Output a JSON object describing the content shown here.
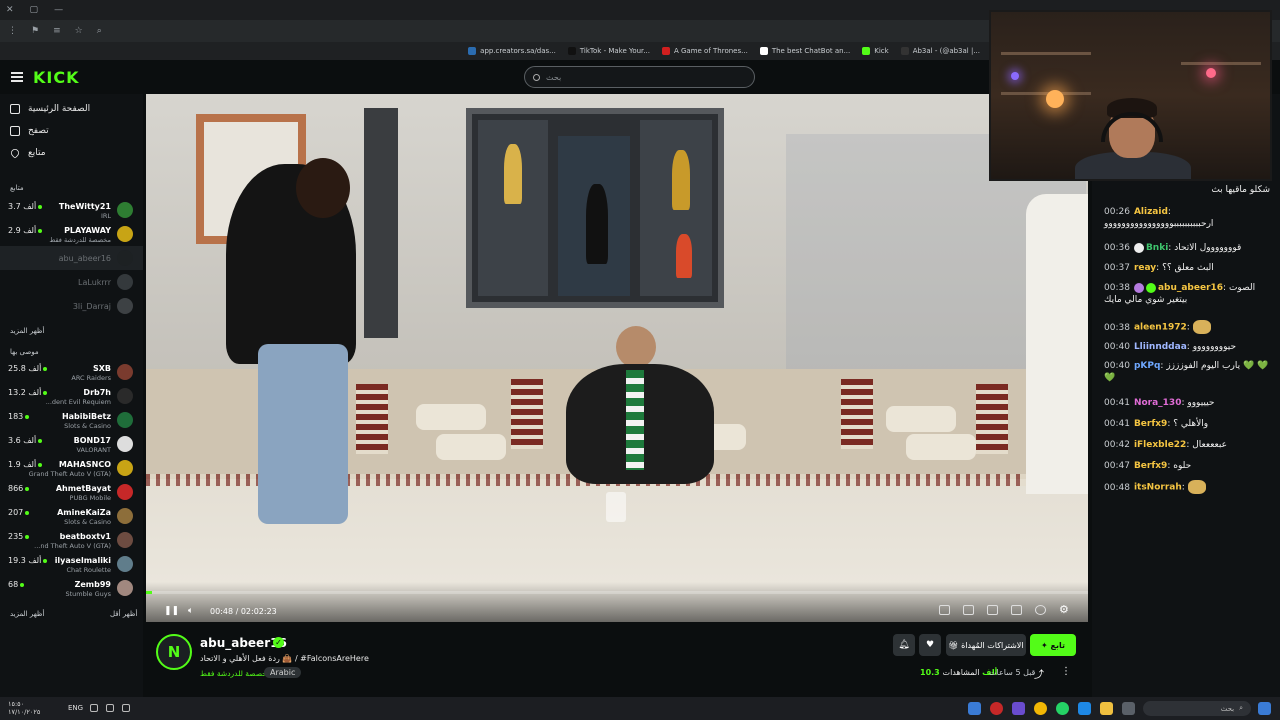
{
  "browser": {
    "tab_hint": "kic",
    "bookmarks": [
      {
        "label": "app.creators.sa/das...",
        "color": "#2b6cb0"
      },
      {
        "label": "TikTok - Make Your...",
        "color": "#111111"
      },
      {
        "label": "A Game of Thrones...",
        "color": "#d11f1f"
      },
      {
        "label": "The best ChatBot an...",
        "color": "#ffffff"
      },
      {
        "label": "Kick",
        "color": "#53fc18"
      },
      {
        "label": "Ab3al - (@ab3al |...",
        "color": "#333333"
      }
    ]
  },
  "header": {
    "logo": "KICK",
    "search_placeholder": "بحث"
  },
  "sidebar": {
    "nav": [
      {
        "label": "الصفحة الرئيسية",
        "icon": "home-icon"
      },
      {
        "label": "تصفح",
        "icon": "browse-icon"
      },
      {
        "label": "متابع",
        "icon": "heart-icon"
      }
    ],
    "following_label": "متابع",
    "following": [
      {
        "count": "3.7 ألف",
        "name": "TheWitty21",
        "category": "IRL",
        "live": true,
        "avatar": "#2e7d32"
      },
      {
        "count": "2.9 ألف",
        "name": "PLAYAWAY",
        "category": "مخصصة للدردشة فقط",
        "live": true,
        "avatar": "#c8a415"
      },
      {
        "count": "",
        "name": "abu_abeer16",
        "category": "",
        "live": false,
        "active": true,
        "avatar": "#1b1f22"
      },
      {
        "count": "",
        "name": "LaLukrrr",
        "category": "",
        "live": false,
        "avatar": "#5a5f63"
      },
      {
        "count": "",
        "name": "3li_Darraj",
        "category": "",
        "live": false,
        "avatar": "#6b6f73"
      }
    ],
    "show_more_following": "أظهر المزيد",
    "recommended_label": "موصى بها",
    "recommended": [
      {
        "count": "25.8 ألف",
        "name": "SXB",
        "category": "ARC Raiders",
        "avatar": "#7a3b2e"
      },
      {
        "count": "13.2 ألف",
        "name": "Drb7h",
        "category": "...dent Evil Requiem",
        "avatar": "#2a2a2a"
      },
      {
        "count": "183",
        "name": "HabibiBetz",
        "category": "Slots & Casino",
        "avatar": "#1f6d3a"
      },
      {
        "count": "3.6 ألف",
        "name": "BOND17",
        "category": "VALORANT",
        "avatar": "#dddddd"
      },
      {
        "count": "1.9 ألف",
        "name": "MAHASNCO",
        "category": "Grand Theft Auto V (GTA)",
        "avatar": "#c8a415"
      },
      {
        "count": "866",
        "name": "AhmetBayat",
        "category": "PUBG Mobile",
        "avatar": "#c62828"
      },
      {
        "count": "207",
        "name": "AmineKaiZa",
        "category": "Slots & Casino",
        "avatar": "#8d6e3a"
      },
      {
        "count": "235",
        "name": "beatboxtv1",
        "category": "...nd Theft Auto V (GTA)",
        "avatar": "#6d4c41"
      },
      {
        "count": "19.3 ألف",
        "name": "ilyaselmaliki",
        "category": "Chat Roulette",
        "avatar": "#607d8b"
      },
      {
        "count": "68",
        "name": "Zemb99",
        "category": "Stumble Guys",
        "avatar": "#a1887f"
      }
    ],
    "show_more_recommended": "أظهر المزيد",
    "show_less": "أظهر أقل"
  },
  "player": {
    "progress_fraction": 0.006,
    "time_text": "00:48 / 02:02:23"
  },
  "stream": {
    "channel": "abu_abeer16",
    "title": "ردة فعل الأهلي و الاتحاد 👜 / #FalconsAreHere",
    "category": "مخصصة للدردشة فقط",
    "language": "Arabic",
    "follow_label": "تابع",
    "gift_label": "الاشتراكات المُهداة",
    "viewers_value": "10.3 ألف",
    "viewers_label": "المشاهدات",
    "uptime": "قبل 5 ساعات",
    "accent": "#53fc18"
  },
  "chat": {
    "messages": [
      {
        "time": "",
        "user": "",
        "color": "#e8e8e8",
        "text": "شكلو ماقيها بث"
      },
      {
        "time": "00:26",
        "user": "Alizaid",
        "color": "#f5c542",
        "text": "ارحببببببببببوووووووووووووووو"
      },
      {
        "time": "00:36",
        "user": "Bnki",
        "color": "#3ec46d",
        "text": "قووووووول الاتحاد",
        "badge": "soccer"
      },
      {
        "time": "00:37",
        "user": "reay",
        "color": "#f5c542",
        "text": "البث معلق ؟؟"
      },
      {
        "time": "00:38",
        "user": "abu_abeer16",
        "color": "#f5c542",
        "text": "الصوت بيتغير شوي مالي مايك",
        "badge": "mod"
      },
      {
        "time": "00:38",
        "user": "aleen1972",
        "color": "#f5c542",
        "text": "",
        "emote": "#d8b15a"
      },
      {
        "time": "00:40",
        "user": "Lliinnddaa",
        "color": "#9fb7ff",
        "text": "حيوووووووو"
      },
      {
        "time": "00:40",
        "user": "pKPq",
        "color": "#6fa8ff",
        "text": "يارب اليوم الفوزززز 💚 💚 💚"
      },
      {
        "time": "00:41",
        "user": "Nora_130",
        "color": "#e06cd6",
        "text": "حيييووو"
      },
      {
        "time": "00:41",
        "user": "Berfx9",
        "color": "#f5c542",
        "text": "والأهلي ؟"
      },
      {
        "time": "00:42",
        "user": "iFlexble22",
        "color": "#f5c542",
        "text": "عبععععال"
      },
      {
        "time": "00:47",
        "user": "Berfx9",
        "color": "#f5c542",
        "text": "حلوه"
      },
      {
        "time": "00:48",
        "user": "itsNorrah",
        "color": "#f5c542",
        "text": "",
        "emote": "#d8b15a"
      }
    ]
  },
  "taskbar": {
    "clock_time": "١٥:٥٠",
    "clock_date": "١٧/١٠/٢٠٢٥",
    "lang": "ENG",
    "search_placeholder": "بحث"
  }
}
